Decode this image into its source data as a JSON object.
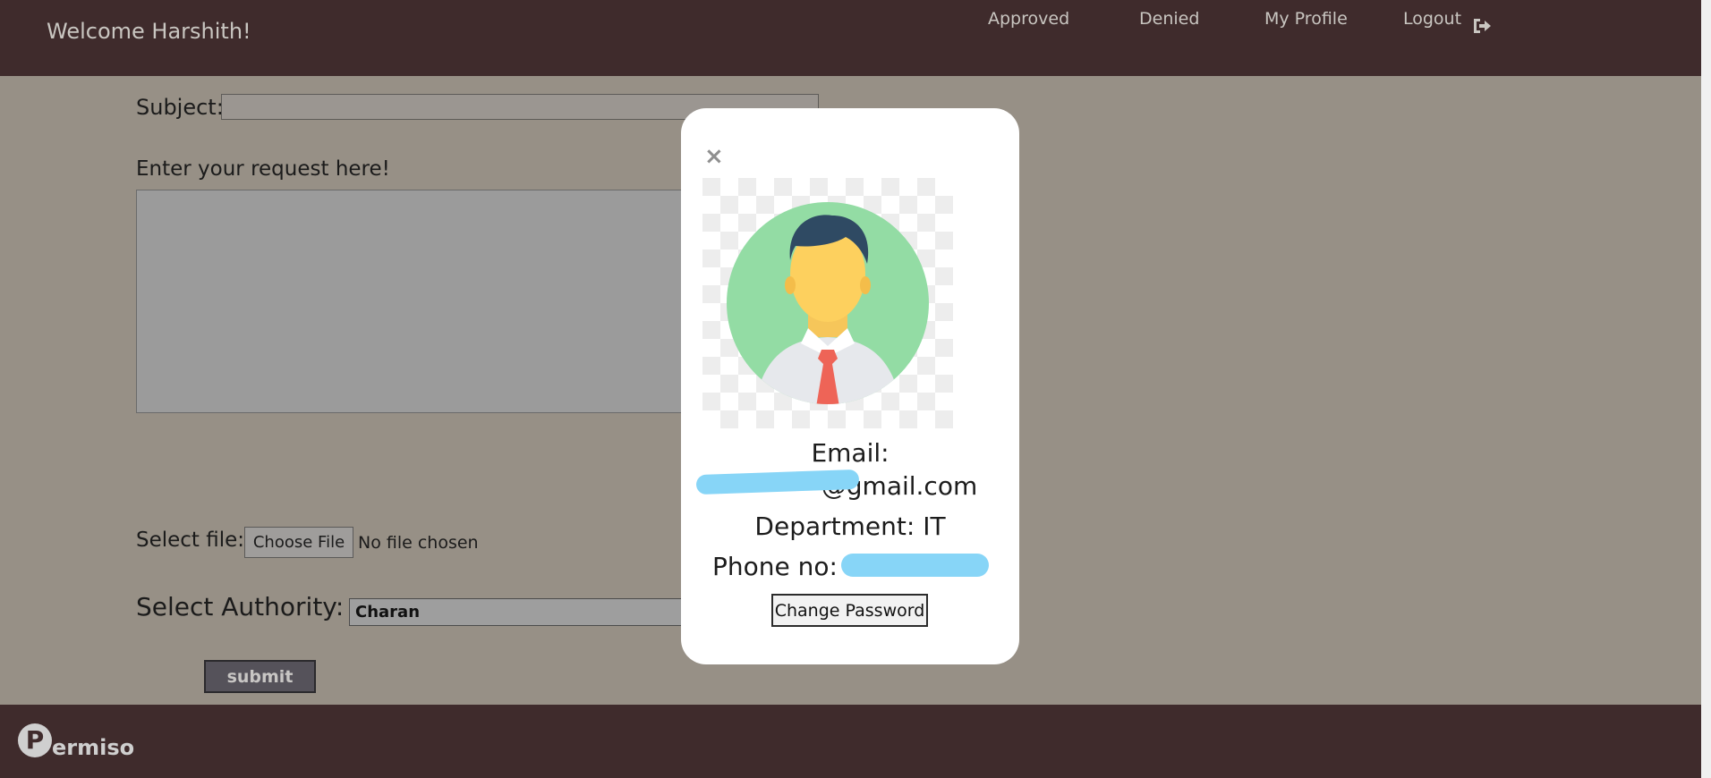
{
  "header": {
    "welcome": "Welcome Harshith!",
    "nav": [
      "Approved",
      "Denied",
      "My Profile",
      "Logout"
    ]
  },
  "form": {
    "subject_label": "Subject:",
    "subject_value": "",
    "request_label": "Enter your request here!",
    "request_value": "",
    "file_label": "Select file:",
    "choose_file": "Choose File",
    "no_file": "No file chosen",
    "authority_label": "Select Authority:",
    "authority_selected": "Charan",
    "submit": "submit"
  },
  "modal": {
    "close": "×",
    "email_label": "Email:",
    "email_value": "@gmail.com",
    "department": "Department: IT",
    "phone_label": "Phone no:",
    "change_password": "Change Password"
  },
  "footer": {
    "logo_letter": "P",
    "brand": "ermiso"
  },
  "colors": {
    "bar": "#3f2b2c",
    "overlay": "#979086",
    "redaction": "#87d5f7"
  }
}
